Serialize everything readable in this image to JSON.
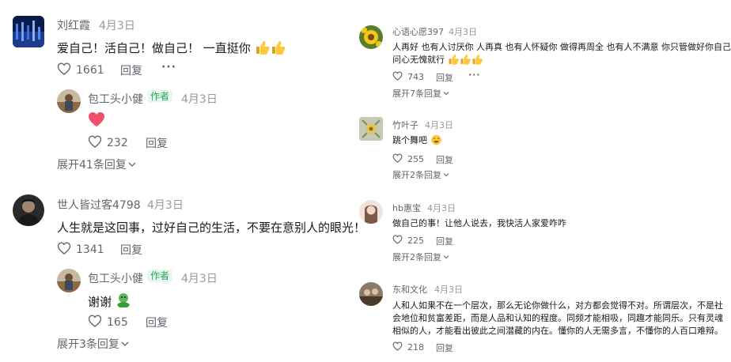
{
  "left": {
    "c1": {
      "name": "刘红霞",
      "date": "4月3日",
      "text": "爱自己！活自己！做自己！  一直挺你",
      "likes": "1661",
      "reply": "回复",
      "more": "···",
      "sub": {
        "name": "包工头小健",
        "badge": "作者",
        "date": "4月3日",
        "likes": "232",
        "reply": "回复"
      },
      "expand": "展开41条回复"
    },
    "c2": {
      "name": "世人皆过客4798",
      "date": "4月3日",
      "text": "人生就是这回事，过好自己的生活，不要在意别人的眼光！",
      "likes": "1341",
      "reply": "回复",
      "sub": {
        "name": "包工头小健",
        "badge": "作者",
        "date": "4月3日",
        "text": "谢谢",
        "likes": "165",
        "reply": "回复"
      },
      "expand": "展开3条回复"
    }
  },
  "right": {
    "c1": {
      "name": "心语心愿397",
      "date": "4月3日",
      "text1": "人再好  也有人讨厌你  人再真  也有人怀疑你  做得再周全  也有人不满意  你只管做好你自己",
      "text2": "问心无愧就行",
      "likes": "743",
      "reply": "回复",
      "more": "···",
      "expand": "展开7条回复"
    },
    "c2": {
      "name": "竹叶子",
      "date": "4月3日",
      "text": "跳个舞吧",
      "likes": "255",
      "reply": "回复",
      "expand": "展开2条回复"
    },
    "c3": {
      "name": "hb惠宝",
      "date": "4月3日",
      "text": "做自己的事！让他人说去，我快活人家爱咋咋",
      "likes": "225",
      "reply": "回复",
      "expand": "展开2条回复"
    },
    "c4": {
      "name": "东和文化",
      "date": "4月3日",
      "text1": "人和人如果不在一个层次，那么无论你做什么，对方都会觉得不对。所谓层次，不是社",
      "text2": "会地位和贫富差距，而是人品和认知的程度。同频才能相吸，同趣才能同乐。只有灵魂",
      "text3": "相似的人，才能看出彼此之间潜藏的内在。懂你的人无需多言，不懂你的人百口难辩。",
      "likes": "218",
      "reply": "回复"
    }
  },
  "colors": {
    "accent_green": "#26a65b",
    "text_gray": "#61666d",
    "date_gray": "#9499a0",
    "heart_red": "#f0506e"
  },
  "icons": [
    "heart-outline-icon",
    "chevron-down-icon",
    "thumbs-up-emoji",
    "heart-emoji",
    "hug-emoji",
    "laugh-emoji"
  ]
}
